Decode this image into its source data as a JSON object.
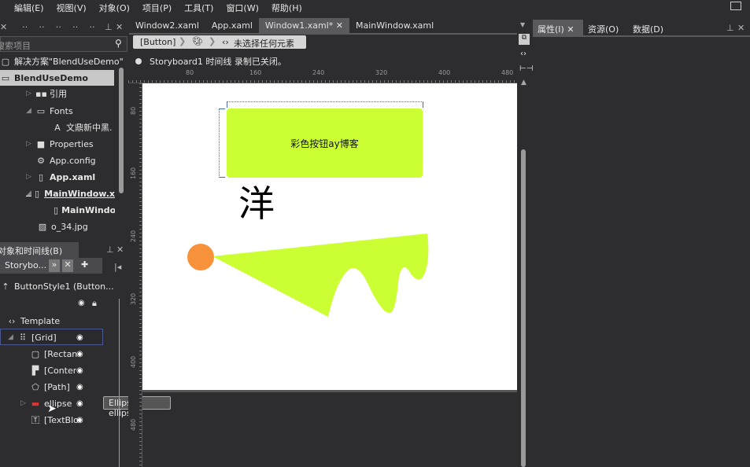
{
  "menu": [
    "編辑(E)",
    "视图(V)",
    "对象(O)",
    "项目(P)",
    "工具(T)",
    "窗口(W)",
    "帮助(H)"
  ],
  "project_panel": {
    "search_placeholder": "搜索项目",
    "solution": "解决方案\"BlendUseDemo\"",
    "project": "BlendUseDemo",
    "items": [
      {
        "label": "引用",
        "icon": "reference-icon",
        "expander": "collapsed"
      },
      {
        "label": "Fonts",
        "icon": "folder-icon",
        "expander": "expanded"
      },
      {
        "label": "文鼎新中黑.",
        "icon": "font-icon",
        "expander": ""
      },
      {
        "label": "Properties",
        "icon": "folder-icon",
        "expander": "collapsed"
      },
      {
        "label": "App.config",
        "icon": "config-icon",
        "expander": ""
      },
      {
        "label": "App.xaml",
        "icon": "xaml-file-icon",
        "expander": "collapsed"
      },
      {
        "label": "MainWindow.x",
        "icon": "xaml-file-icon",
        "expander": "expanded"
      },
      {
        "label": "MainWindo",
        "icon": "file-icon",
        "expander": ""
      },
      {
        "label": "o_34.jpg",
        "icon": "image-icon",
        "expander": ""
      }
    ]
  },
  "objects_panel": {
    "title": "对象和时间线(B)",
    "storyboard": "Storybo...",
    "style": "ButtonStyle1 (Button...",
    "template": "Template",
    "tree": [
      {
        "label": "[Grid]",
        "icon": "grid-icon"
      },
      {
        "label": "[Rectan",
        "icon": "rectangle-icon"
      },
      {
        "label": "[Conter",
        "icon": "content-presenter-icon"
      },
      {
        "label": "[Path]",
        "icon": "path-icon"
      },
      {
        "label": "ellipse",
        "icon": "ellipse-icon"
      },
      {
        "label": "[TextBlo",
        "icon": "textblock-icon"
      }
    ],
    "tooltip": "Ellipse ellipse"
  },
  "doc_tabs": [
    {
      "label": "Window2.xaml",
      "active": false
    },
    {
      "label": "App.xaml",
      "active": false
    },
    {
      "label": "Window1.xaml*",
      "active": true
    },
    {
      "label": "MainWindow.xaml",
      "active": false
    }
  ],
  "breadcrumb": {
    "first": "[Button]",
    "last": "未选择任何元素"
  },
  "storyboard_status": "Storyboard1 时间线 录制已关闭。",
  "ruler": {
    "h": [
      "80",
      "160",
      "240",
      "320",
      "400",
      "480"
    ],
    "v": [
      "80",
      "160",
      "240",
      "320",
      "400",
      "480"
    ]
  },
  "artboard": {
    "button_text": "彩色按钮ay博客",
    "glyph": "洋",
    "colors": {
      "button": "#ccff33",
      "shape": "#ccff33",
      "ellipse": "#f7913a"
    }
  },
  "right_tabs": [
    "属性(I)",
    "资源(O)",
    "数据(D)"
  ]
}
